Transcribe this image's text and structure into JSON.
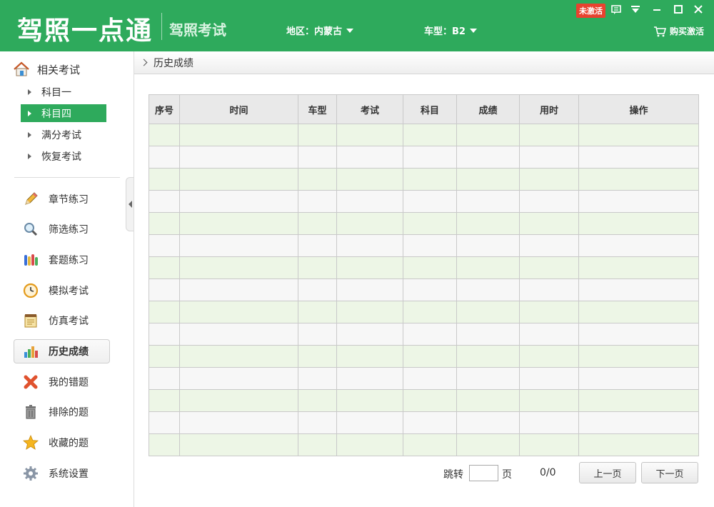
{
  "header": {
    "app_title": "驾照一点通",
    "subtitle": "驾照考试",
    "region": "地区：内蒙古",
    "car_type": "车型：B2",
    "activation_badge": "未激活",
    "buy_label": "购买激活"
  },
  "sidebar": {
    "heading": "相关考试",
    "sub_items": [
      {
        "label": "科目一",
        "active": false
      },
      {
        "label": "科目四",
        "active": true
      },
      {
        "label": "满分考试",
        "active": false
      },
      {
        "label": "恢复考试",
        "active": false
      }
    ],
    "menu": [
      {
        "label": "章节练习",
        "icon": "pencil-icon"
      },
      {
        "label": "筛选练习",
        "icon": "magnifier-icon"
      },
      {
        "label": "套题练习",
        "icon": "test-tubes-icon"
      },
      {
        "label": "模拟考试",
        "icon": "clock-icon"
      },
      {
        "label": "仿真考试",
        "icon": "notepad-icon"
      },
      {
        "label": "历史成绩",
        "icon": "bar-chart-icon",
        "active": true
      },
      {
        "label": "我的错题",
        "icon": "red-x-icon"
      },
      {
        "label": "排除的题",
        "icon": "trash-icon"
      },
      {
        "label": "收藏的题",
        "icon": "star-icon"
      },
      {
        "label": "系统设置",
        "icon": "gear-icon"
      }
    ]
  },
  "main": {
    "breadcrumb": "历史成绩",
    "table": {
      "columns": [
        "序号",
        "时间",
        "车型",
        "考试",
        "科目",
        "成绩",
        "用时",
        "操作"
      ],
      "rows": []
    },
    "pager": {
      "jump_label": "跳转",
      "jump_value": "",
      "page_label": "页",
      "page_count": "0/0",
      "prev_label": "上一页",
      "next_label": "下一页"
    }
  }
}
